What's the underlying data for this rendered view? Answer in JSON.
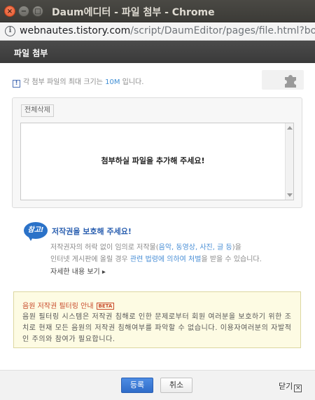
{
  "window": {
    "title": "Daum에디터 - 파일 첨부 - Chrome",
    "close_glyph": "×",
    "min_glyph": "−",
    "max_glyph": "□"
  },
  "address_bar": {
    "info_glyph": "i",
    "host": "webnautes.tistory.com",
    "path": "/script/DaumEditor/pages/file.html?boxonl"
  },
  "dialog": {
    "title": "파일 첨부"
  },
  "notice": {
    "icon_glyph": "!",
    "prefix": "각 첨부 파일의 최대 크기는 ",
    "size": "10M",
    "suffix": " 입니다."
  },
  "upload": {
    "delete_all_label": "전체삭제",
    "empty_text": "첨부하실 파일을 추가해 주세요!"
  },
  "copyright": {
    "badge_text": "참고!",
    "heading": "저작권을 보호해 주세요!",
    "line1_a": "저작권자의 허락 없이 임의로 저작물(",
    "line1_link": "음악, 동영상, 사진, 글 등",
    "line1_b": ")을",
    "line2_a": "인터넷 게시판에 올릴 경우 ",
    "line2_link": "관련 법령에 의하여 처벌",
    "line2_b": "을 받을 수 있습니다.",
    "more_label": "자세한 내용 보기 ▸"
  },
  "filter": {
    "title": "음원 저작권 필터링 안내",
    "beta": "BETA",
    "text": "음원 필터링 시스템은 저작권 침해로 인한 문제로부터 회원 여러분을 보호하기 위한 조치로 현재 모든 음원의 저작권 침해여부를 파악할 수 없습니다. 이용자여러분의 자발적인 주의와 참여가 필요합니다."
  },
  "footer": {
    "register_label": "등록",
    "cancel_label": "취소",
    "close_label": "닫기",
    "close_glyph": "×"
  },
  "colors": {
    "accent_blue": "#2f6cc9",
    "link_blue": "#3f8ed4",
    "filter_title": "#c84a2a",
    "filter_bg": "#fdfbe3"
  }
}
